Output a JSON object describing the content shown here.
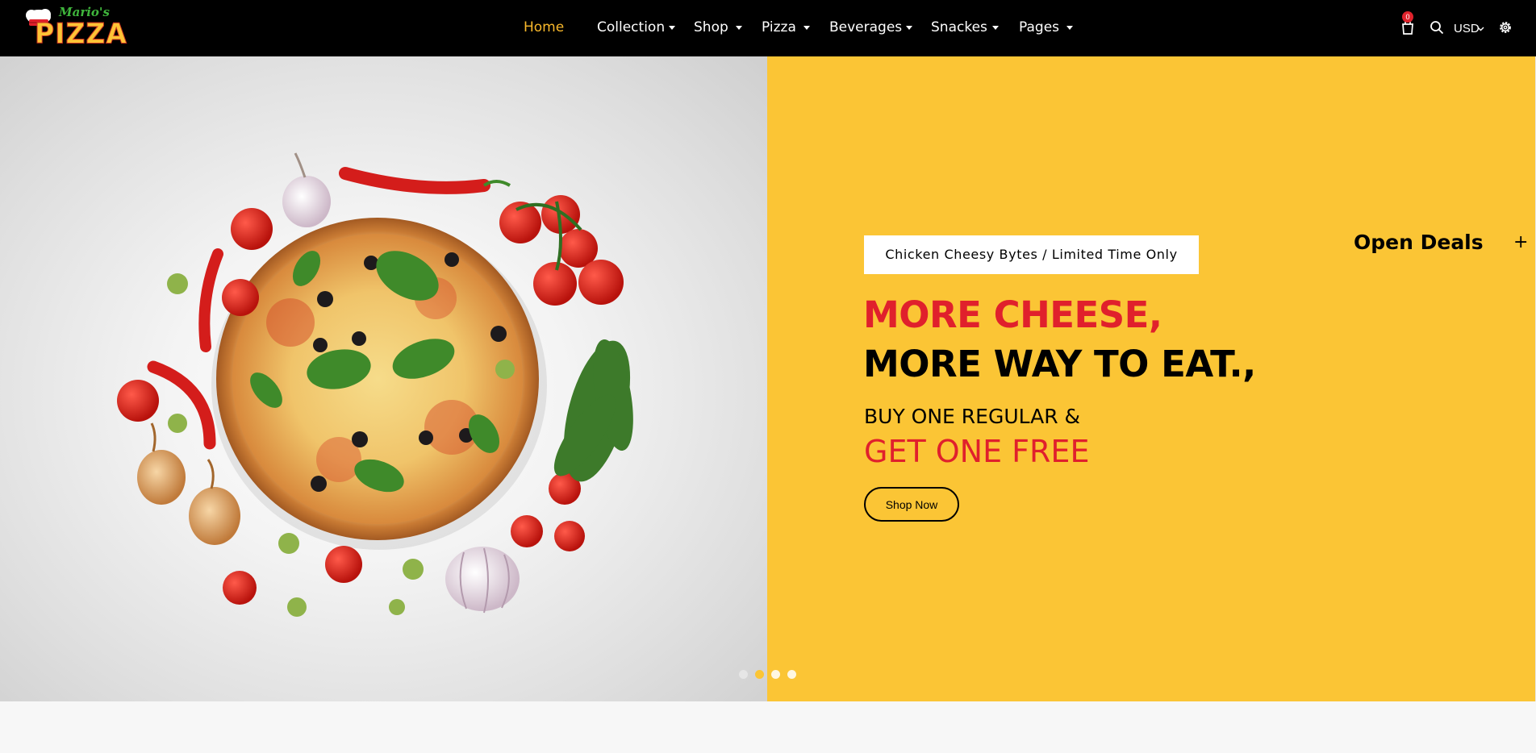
{
  "brand": {
    "logo_script": "Mario's",
    "logo_main": "PIZZA"
  },
  "nav": {
    "items": [
      {
        "label": "Home",
        "active": true,
        "has_dropdown": false
      },
      {
        "label": "Collection",
        "active": false,
        "has_dropdown": true
      },
      {
        "label": "Shop",
        "active": false,
        "has_dropdown": true
      },
      {
        "label": "Pizza",
        "active": false,
        "has_dropdown": true
      },
      {
        "label": "Beverages",
        "active": false,
        "has_dropdown": true
      },
      {
        "label": "Snackes",
        "active": false,
        "has_dropdown": true
      },
      {
        "label": "Pages",
        "active": false,
        "has_dropdown": true
      }
    ]
  },
  "header_actions": {
    "cart_count": "0",
    "currency": "USD",
    "icons": [
      "cart-icon",
      "search-icon",
      "chevron-down-icon",
      "gear-icon"
    ]
  },
  "hero": {
    "promo_tag": "Chicken Cheesy Bytes / Limited Time Only",
    "headline_line1": "MORE CHEESE,",
    "headline_line2": "MORE WAY TO EAT.,",
    "sub_line1": "BUY ONE REGULAR &",
    "sub_line2": "GET ONE FREE",
    "cta_label": "Shop Now",
    "slider_dots": 4,
    "active_dot": 2
  },
  "sidebar_panel": {
    "title": "Open Deals",
    "toggle": "+"
  },
  "colors": {
    "header_bg": "#000000",
    "accent_yellow": "#fbc535",
    "nav_active": "#f9b82b",
    "brand_red": "#e0202c"
  }
}
